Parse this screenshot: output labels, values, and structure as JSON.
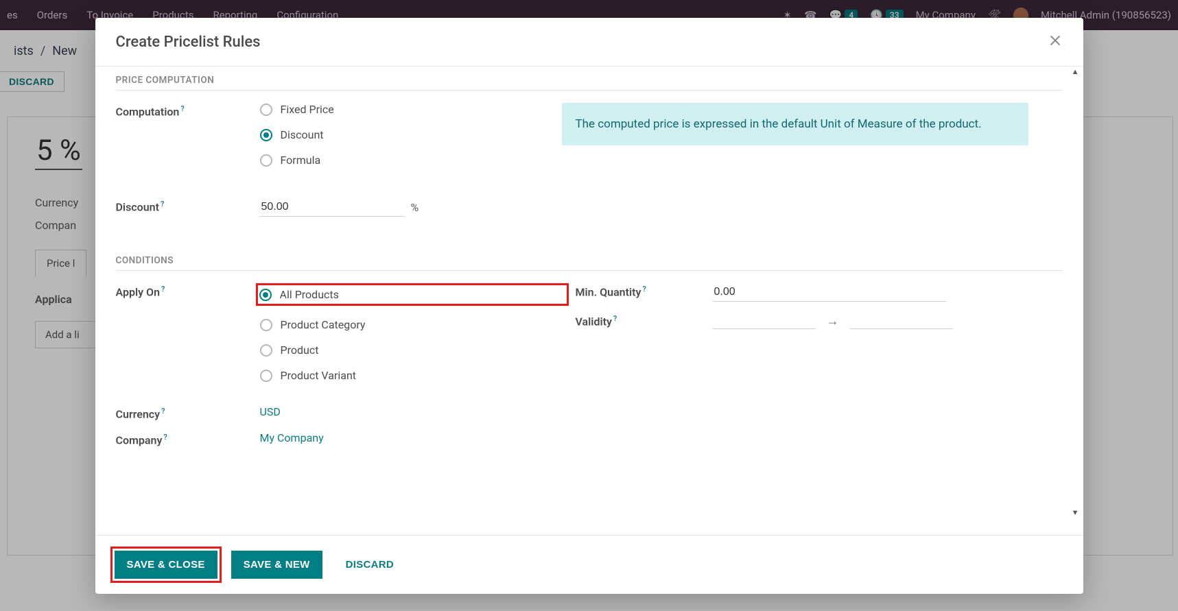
{
  "topnav": {
    "items": [
      "es",
      "Orders",
      "To Invoice",
      "Products",
      "Reporting",
      "Configuration"
    ],
    "msg_badge": "4",
    "activity_badge": "33",
    "company": "My Company",
    "user": "Mitchell Admin (190856523)"
  },
  "bg": {
    "crumb_parent": "ists",
    "crumb_current": "New",
    "discard": "DISCARD",
    "bigvalue": "5 %",
    "currency_label": "Currency",
    "company_label": "Compan",
    "tab_label": "Price l",
    "applica_label": "Applica",
    "addline_label": "Add a li"
  },
  "modal": {
    "title": "Create Pricelist Rules",
    "sections": {
      "price_computation": "PRICE COMPUTATION",
      "conditions": "CONDITIONS"
    },
    "labels": {
      "computation": "Computation",
      "discount": "Discount",
      "apply_on": "Apply On",
      "currency": "Currency",
      "company": "Company",
      "min_quantity": "Min. Quantity",
      "validity": "Validity"
    },
    "computation_options": [
      "Fixed Price",
      "Discount",
      "Formula"
    ],
    "computation_selected": "Discount",
    "discount_value": "50.00",
    "discount_suffix": "%",
    "infobox": "The computed price is expressed in the default Unit of Measure of the product.",
    "apply_on_options": [
      "All Products",
      "Product Category",
      "Product",
      "Product Variant"
    ],
    "apply_on_selected": "All Products",
    "currency_value": "USD",
    "company_value": "My Company",
    "min_quantity_value": "0.00",
    "validity_start": "",
    "validity_end": "",
    "footer": {
      "save_close": "SAVE & CLOSE",
      "save_new": "SAVE & NEW",
      "discard": "DISCARD"
    }
  }
}
